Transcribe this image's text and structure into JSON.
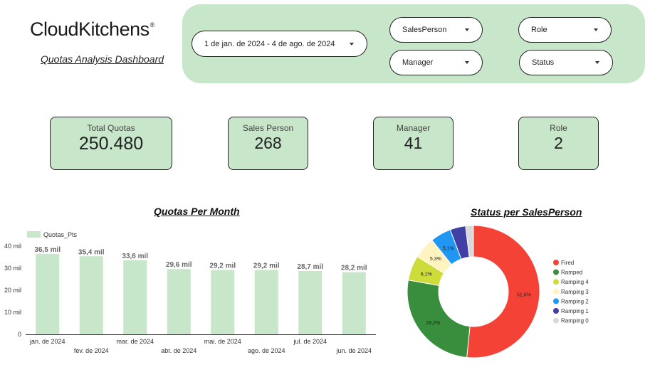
{
  "brand": {
    "logo_text": "CloudKitchens",
    "registered": "®",
    "subtitle": "Quotas Analysis Dashboard"
  },
  "filters": {
    "date_range": "1 de jan. de 2024 - 4 de ago. de 2024",
    "salesperson": "SalesPerson",
    "role": "Role",
    "manager": "Manager",
    "status": "Status"
  },
  "kpis": [
    {
      "label": "Total Quotas",
      "value": "250.480"
    },
    {
      "label": "Sales Person",
      "value": "268"
    },
    {
      "label": "Manager",
      "value": "41"
    },
    {
      "label": "Role",
      "value": "2"
    }
  ],
  "colors": {
    "panel": "#c8e6c9",
    "bar": "#c8e6c9",
    "fired": "#f44336",
    "ramped": "#388e3c",
    "ramping4": "#cddc39",
    "ramping3": "#fff3bf",
    "ramping2": "#2196f3",
    "ramping1": "#3f3fa5",
    "ramping0": "#d9d9d9"
  },
  "chart_data": [
    {
      "type": "bar",
      "title": "Quotas Per Month",
      "categories": [
        "jan. de 2024",
        "fev. de 2024",
        "mar. de 2024",
        "abr. de 2024",
        "mai. de 2024",
        "ago. de 2024",
        "jul. de 2024",
        "jun. de 2024"
      ],
      "series": [
        {
          "name": "Quotas_Pts",
          "values": [
            36500,
            35400,
            33600,
            29600,
            29200,
            29200,
            28700,
            28200
          ]
        }
      ],
      "data_labels": [
        "36,5 mil",
        "35,4 mil",
        "33,6 mil",
        "29,6 mil",
        "29,2 mil",
        "29,2 mil",
        "28,7 mil",
        "28,2 mil"
      ],
      "yticks": [
        "0",
        "10 mil",
        "20 mil",
        "30 mil",
        "40 mil"
      ],
      "ylim": [
        0,
        40000
      ],
      "legend": "top-left",
      "grid": false
    },
    {
      "type": "pie",
      "title": "Status per SalesPerson",
      "labels": [
        "Fired",
        "Ramped",
        "Ramping 4",
        "Ramping 3",
        "Ramping 2",
        "Ramping 1",
        "Ramping 0"
      ],
      "values": [
        51.6,
        26.2,
        6.1,
        5.3,
        5.1,
        3.8,
        1.9
      ],
      "slice_labels": [
        "51,6%",
        "26,2%",
        "6,1%",
        "5,3%",
        "5,1%",
        "",
        ""
      ],
      "colors": [
        "#f44336",
        "#388e3c",
        "#cddc39",
        "#fff3bf",
        "#2196f3",
        "#3f3fa5",
        "#d9d9d9"
      ],
      "donut": true,
      "legend": "right"
    }
  ]
}
